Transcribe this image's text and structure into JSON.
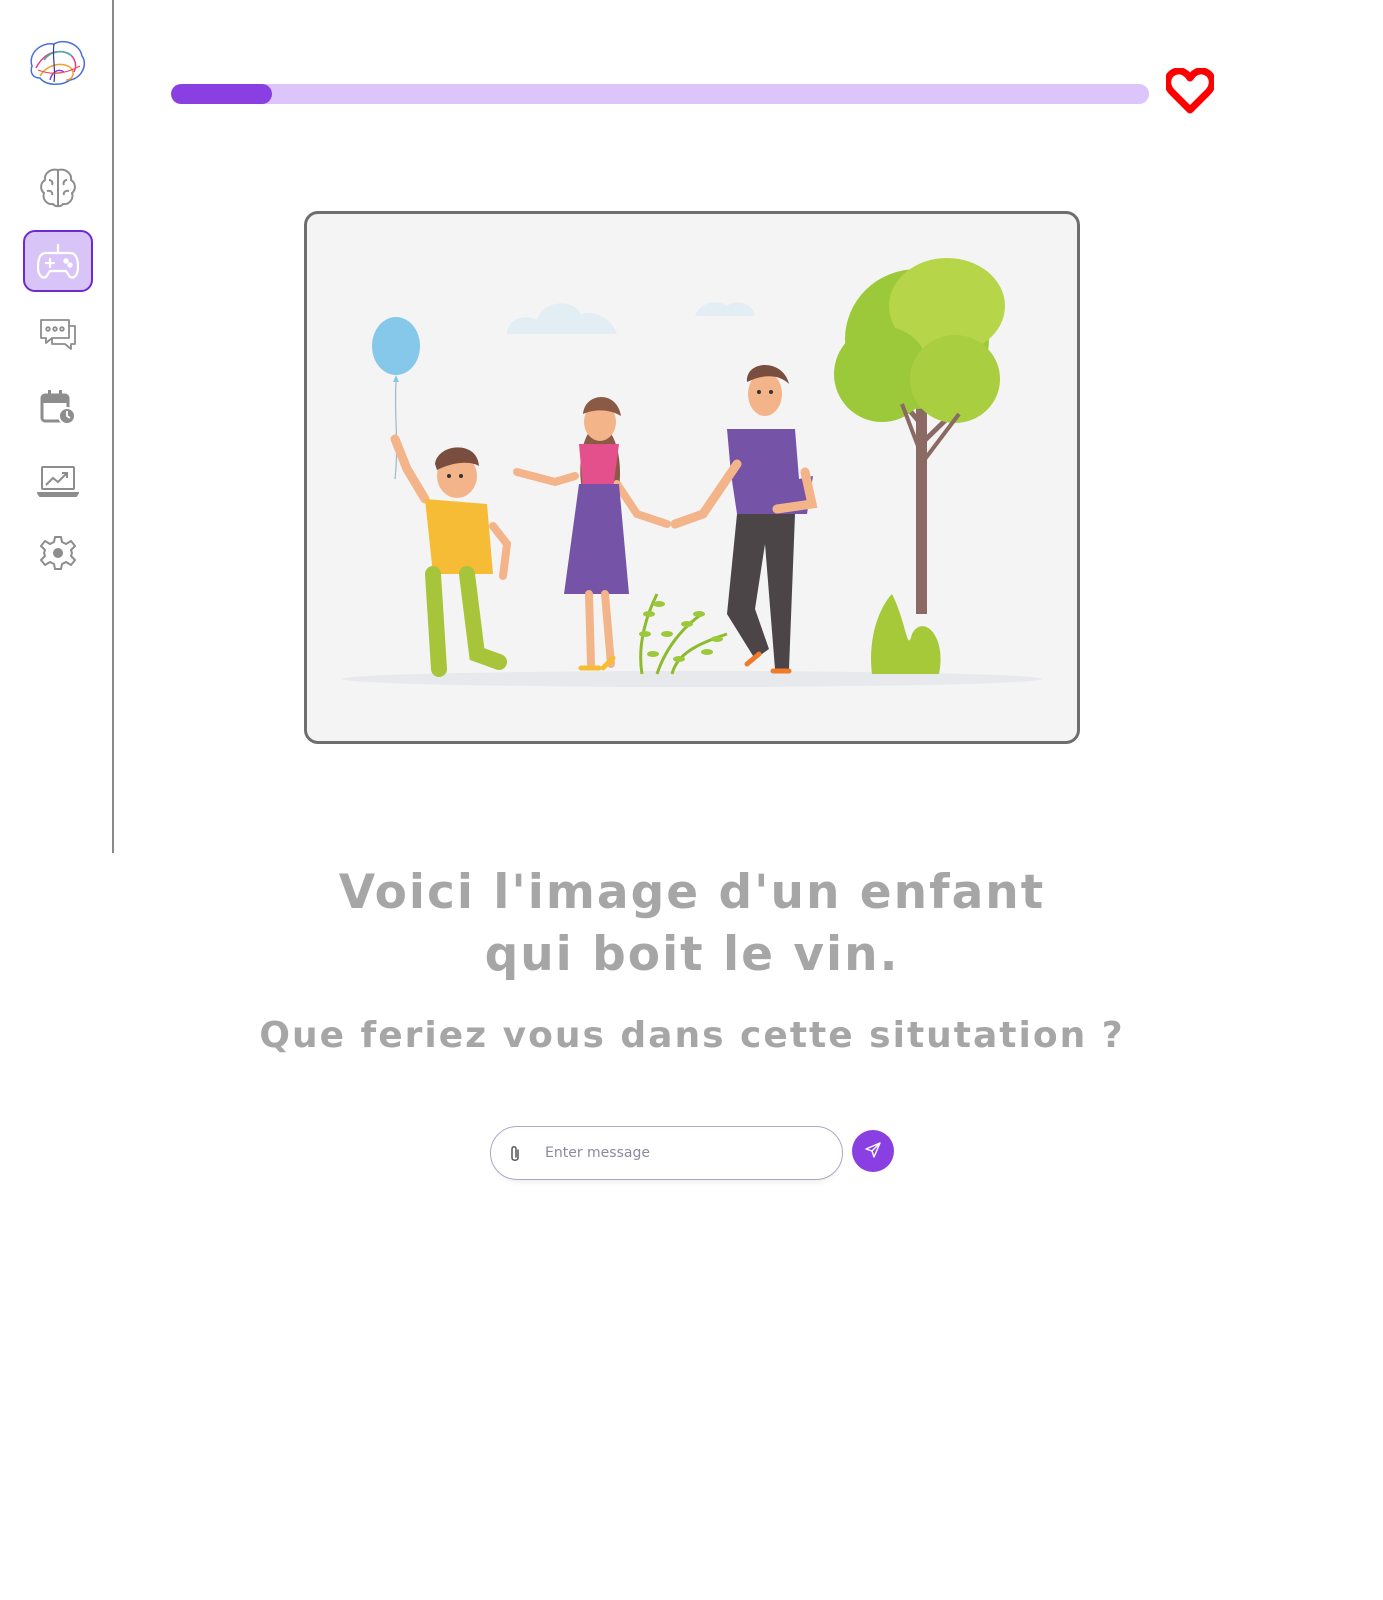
{
  "sidebar": {
    "logo": {
      "icon": "brain-logo-icon"
    },
    "items": [
      {
        "id": "brain",
        "icon": "brain-icon",
        "active": false
      },
      {
        "id": "games",
        "icon": "gamepad-icon",
        "active": true
      },
      {
        "id": "chat",
        "icon": "chat-bubbles-icon",
        "active": false
      },
      {
        "id": "calendar",
        "icon": "calendar-clock-icon",
        "active": false
      },
      {
        "id": "stats",
        "icon": "laptop-chart-icon",
        "active": false
      },
      {
        "id": "settings",
        "icon": "gear-icon",
        "active": false
      }
    ]
  },
  "progress": {
    "value": 0.103
  },
  "lives": {
    "icon": "heart-icon"
  },
  "scene": {
    "icon": "family-park-illustration"
  },
  "prompt": {
    "line1": "Voici l'image d'un enfant",
    "line2": "qui boit le vin."
  },
  "question": "Que feriez vous dans cette situtation ?",
  "message": {
    "placeholder": "Enter message",
    "value": "",
    "attach_icon": "paperclip-icon",
    "send_icon": "send-icon"
  },
  "colors": {
    "accent": "#8a3fe3",
    "accent_light": "#dcc5fa",
    "heart": "#ff0000",
    "muted_text": "#a6a6a6"
  }
}
